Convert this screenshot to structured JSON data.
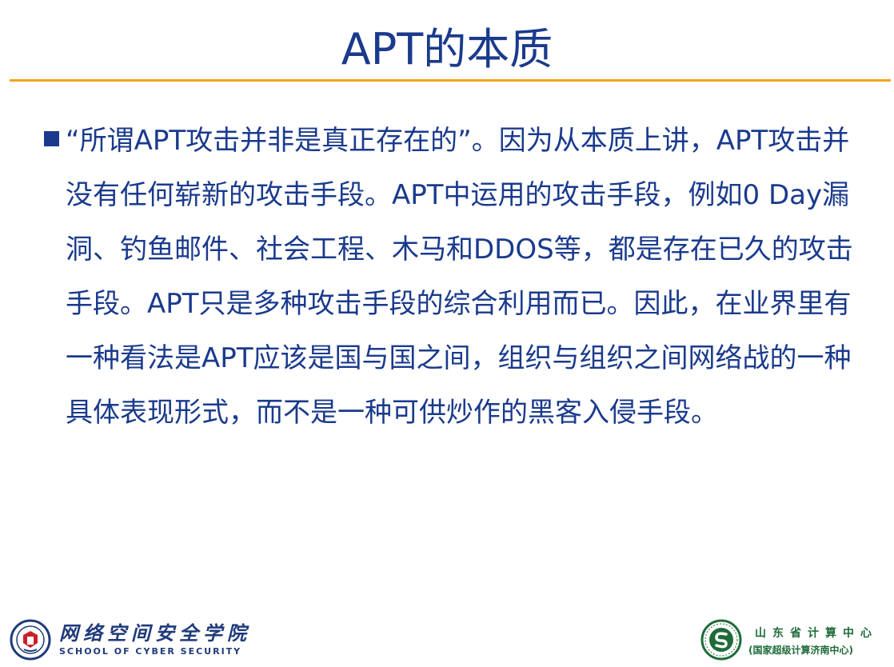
{
  "slide": {
    "title": "APT的本质",
    "bullet_text": "“所谓APT攻击并非是真正存在的”。因为从本质上讲，APT攻击并没有任何崭新的攻击手段。APT中运用的攻击手段，例如0 Day漏洞、钓鱼邮件、社会工程、木马和DDOS等，都是存在已久的攻击手段。APT只是多种攻击手段的综合利用而已。因此，在业界里有一种看法是APT应该是国与国之间，组织与组织之间网络战的一种具体表现形式，而不是一种可供炒作的黑客入侵手段。"
  },
  "footer": {
    "school_name_cn": "网络空间安全学院",
    "school_name_en": "SCHOOL OF CYBER SECURITY",
    "center_name_cn": "山东省计算中心",
    "center_subtitle": "(国家超级计算济南中心)"
  },
  "colors": {
    "title": "#1a3a8c",
    "rule": "#f2a418",
    "text": "#1a3a8c",
    "school": "#1f3a7a",
    "center": "#1f6b3a"
  },
  "icons": {
    "left_logo": "university-emblem-icon",
    "right_logo": "computing-center-emblem-icon"
  }
}
